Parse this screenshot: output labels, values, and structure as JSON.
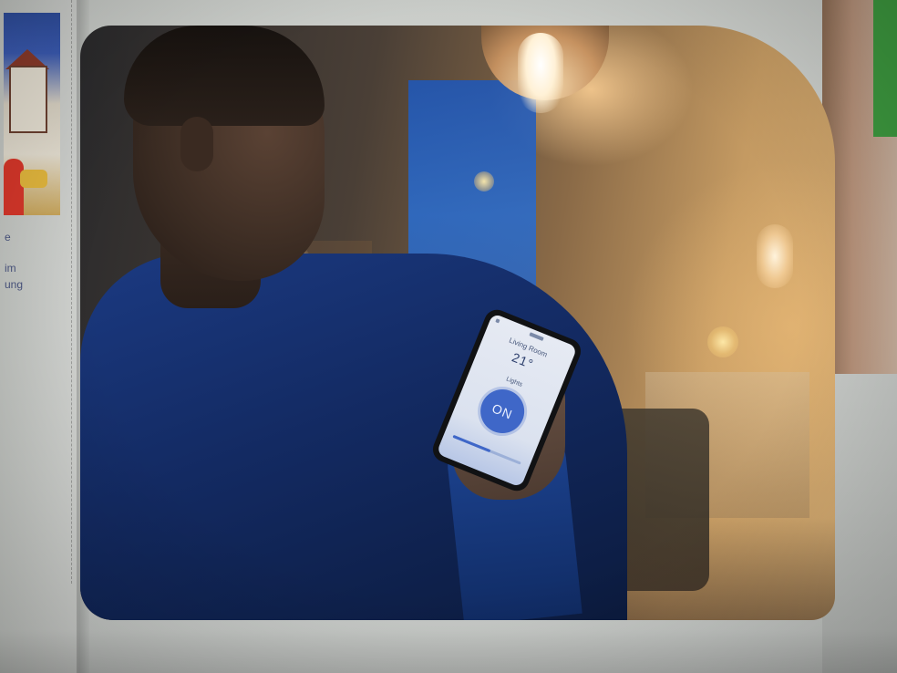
{
  "left_page": {
    "snippet_lines": [
      "e",
      "im",
      "ung"
    ]
  },
  "photo": {
    "phone": {
      "room_name": "Living Room",
      "temperature": "21°",
      "lights_label": "Lights",
      "on_button": "ON",
      "slider_level": 0.55
    }
  },
  "colors": {
    "accent_blue": "#3f67c8",
    "sweater_blue": "#1b3a82",
    "lamp_warm": "#d8ae73"
  }
}
